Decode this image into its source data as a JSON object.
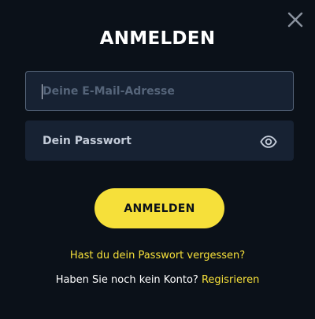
{
  "dialog": {
    "title": "ANMELDEN"
  },
  "email_field": {
    "placeholder": "Deine E-Mail-Adresse",
    "value": ""
  },
  "password_field": {
    "placeholder": "Dein Passwort",
    "value": ""
  },
  "icons": {
    "close": "close-icon",
    "password_visibility": "eye-icon"
  },
  "submit_button": {
    "label": "ANMELDEN"
  },
  "forgot_password": {
    "label": "Hast du dein Passwort vergessen?"
  },
  "register": {
    "prompt": "Haben Sie noch kein Konto?",
    "link_label": "Regisrieren"
  },
  "colors": {
    "background": "#0b1119",
    "field_background": "#172233",
    "accent": "#f6e03a",
    "text": "#ffffff"
  }
}
